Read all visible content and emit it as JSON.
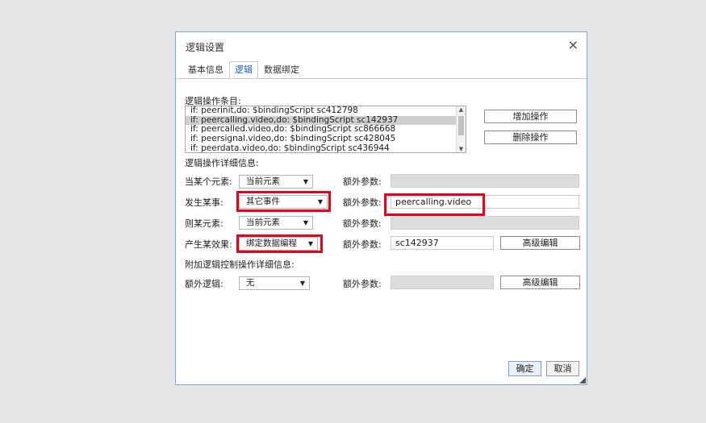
{
  "dialog": {
    "title": "逻辑设置",
    "close_glyph": "×",
    "tabs": [
      "基本信息",
      "逻辑",
      "数据绑定"
    ],
    "active_tab": "逻辑"
  },
  "logic_list": {
    "label": "逻辑操作条目:",
    "items": [
      "if: peerinit,do: $bindingScript sc412798",
      "if: peercalling.video,do: $bindingScript sc142937",
      "if: peercalled.video,do: $bindingScript sc866668",
      "if: peersignal.video,do: $bindingScript sc428045",
      "if: peerdata.video,do: $bindingScript sc436944"
    ],
    "selected_index": 1,
    "add_button": "增加操作",
    "delete_button": "删除操作"
  },
  "detail": {
    "section_label": "逻辑操作详细信息:",
    "rows": [
      {
        "label": "当某个元素:",
        "select": "当前元素",
        "param_label": "额外参数:",
        "param_value": "",
        "param_disabled": true
      },
      {
        "label": "发生某事:",
        "select": "其它事件",
        "param_label": "额外参数:",
        "param_value": "peercalling.video",
        "param_disabled": false
      },
      {
        "label": "则某元素:",
        "select": "当前元素",
        "param_label": "额外参数:",
        "param_value": "",
        "param_disabled": true
      },
      {
        "label": "产生某效果:",
        "select": "绑定数据编程",
        "param_label": "额外参数:",
        "param_value": "sc142937",
        "param_disabled": false,
        "advanced_button": "高级编辑"
      }
    ]
  },
  "extra": {
    "section_label": "附加逻辑控制操作详细信息:",
    "label": "额外逻辑:",
    "select": "无",
    "param_label": "额外参数:",
    "param_value": "",
    "advanced_button": "高级编辑"
  },
  "footer": {
    "ok": "确定",
    "cancel": "取消"
  },
  "colors": {
    "highlight_box": "#e8001c",
    "dialog_border": "#7aa7d6",
    "active_tab_text": "#1a59b7"
  }
}
